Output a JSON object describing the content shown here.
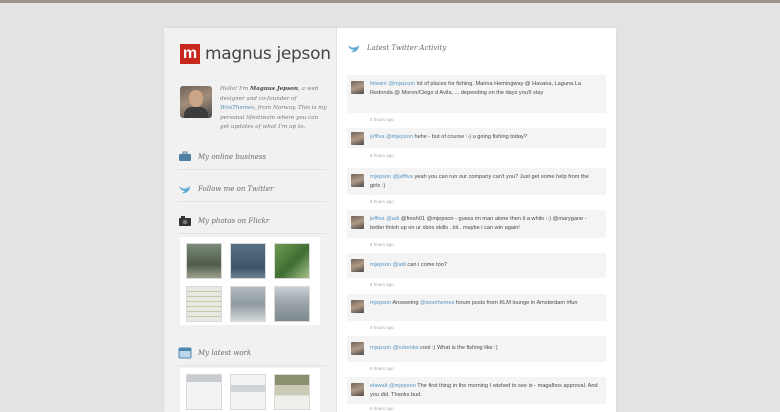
{
  "logo": {
    "mark": "m",
    "name": "magnus jepson"
  },
  "bio": {
    "p1": "Hello! I'm ",
    "name": "Magnus Jepson",
    "p2": ", a web designer and co-founder of ",
    "link": "WooThemes",
    "p3": ", from Norway. This is my personal lifestream where you can get updates of what I'm up to."
  },
  "sections": {
    "business": "My online business",
    "twitter": "Follow me on Twitter",
    "flickr": "My photos on Flickr",
    "work": "My latest work"
  },
  "twitter_heading": "Latest Twitter Activity",
  "tweets": [
    {
      "user": "hiteam",
      "mention": "@mjepson",
      "text": " lot of places for fishing. Marina Hemingway @ Havana, Laguna La Redonda @ Moron/Ciego d Avila, ... depending on the days you'll stay",
      "time": "8 hours ago"
    },
    {
      "user": "jeffiva",
      "mention": "@mjepson",
      "text": " hehe - but of course :-) u going fishing today?",
      "time": "8 hours ago"
    },
    {
      "user": "mjepson",
      "mention": "@jeffiva",
      "text": " yeah you can run our company can't you? Just get some help from the girls :)",
      "time": "8 hours ago"
    },
    {
      "user": "jeffiva",
      "mention": "@adi",
      "text": " @fresh01 @mjepson - guess im man alone then it a while :-) @marygane - better finish up on ur xbox skills ..lol.. maybe i can win again!",
      "time": "8 hours ago"
    },
    {
      "user": "mjepson",
      "mention": "@adi",
      "text": " can i come too?",
      "time": "8 hours ago"
    },
    {
      "user": "mjepson",
      "mention": "@woothemes",
      "text": " forum posts from KLM lounge in Amsterdam #fun",
      "lead": " Answering ",
      "time": "9 hours ago"
    },
    {
      "user": "mjepson",
      "mention": "@rubenko",
      "text": " cool :) What is the fishing like :)",
      "time": "9 hours ago"
    },
    {
      "user": "elawalt",
      "mention": "@mjepson",
      "text": " The first thing in the morning I wished to see is - magalhos approval. And you did. Thanks bud.",
      "time": "9 hours ago"
    }
  ],
  "colors": {
    "brand": "#c7281c",
    "link": "#5b97c4",
    "background": "#e3e3e3"
  }
}
